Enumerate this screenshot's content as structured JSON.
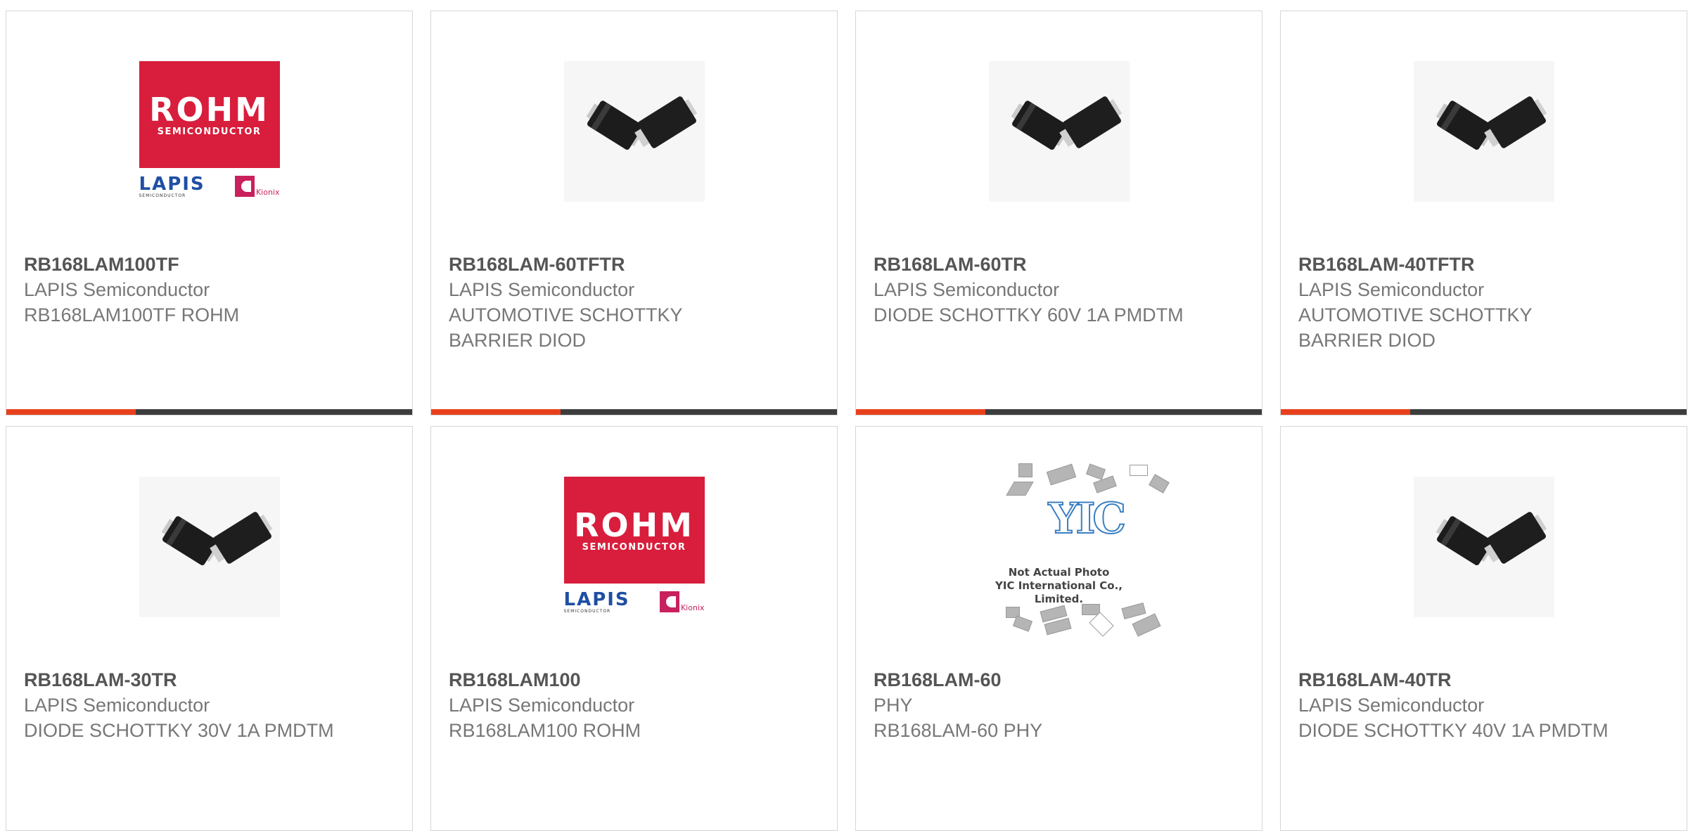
{
  "colors": {
    "accent": "#e8401c",
    "bar": "#3d3d3d",
    "border": "#d6d6d6"
  },
  "logos": {
    "rohm": {
      "word": "ROHM",
      "sub": "SEMICONDUCTOR",
      "lapis": "LAPIS",
      "lapis_sub": "SEMICONDUCTOR",
      "kionix": "Kionix"
    },
    "yic": {
      "word": "YIC",
      "line1": "Not Actual Photo",
      "line2": "YIC International Co., Limited."
    }
  },
  "products": [
    {
      "part_number": "RB168LAM100TF",
      "manufacturer": "LAPIS Semiconductor",
      "description": "RB168LAM100TF ROHM",
      "image": "rohm-logo"
    },
    {
      "part_number": "RB168LAM-60TFTR",
      "manufacturer": "LAPIS Semiconductor",
      "description": "AUTOMOTIVE SCHOTTKY BARRIER DIOD",
      "image": "diode-package"
    },
    {
      "part_number": "RB168LAM-60TR",
      "manufacturer": "LAPIS Semiconductor",
      "description": "DIODE SCHOTTKY 60V 1A PMDTM",
      "image": "diode-package"
    },
    {
      "part_number": "RB168LAM-40TFTR",
      "manufacturer": "LAPIS Semiconductor",
      "description": "AUTOMOTIVE SCHOTTKY BARRIER DIOD",
      "image": "diode-package"
    },
    {
      "part_number": "RB168LAM-30TR",
      "manufacturer": "LAPIS Semiconductor",
      "description": "DIODE SCHOTTKY 30V 1A PMDTM",
      "image": "diode-package"
    },
    {
      "part_number": "RB168LAM100",
      "manufacturer": "LAPIS Semiconductor",
      "description": "RB168LAM100 ROHM",
      "image": "rohm-logo"
    },
    {
      "part_number": "RB168LAM-60",
      "manufacturer": "PHY",
      "description": "RB168LAM-60 PHY",
      "image": "yic-placeholder"
    },
    {
      "part_number": "RB168LAM-40TR",
      "manufacturer": "LAPIS Semiconductor",
      "description": "DIODE SCHOTTKY 40V 1A PMDTM",
      "image": "diode-package"
    }
  ]
}
